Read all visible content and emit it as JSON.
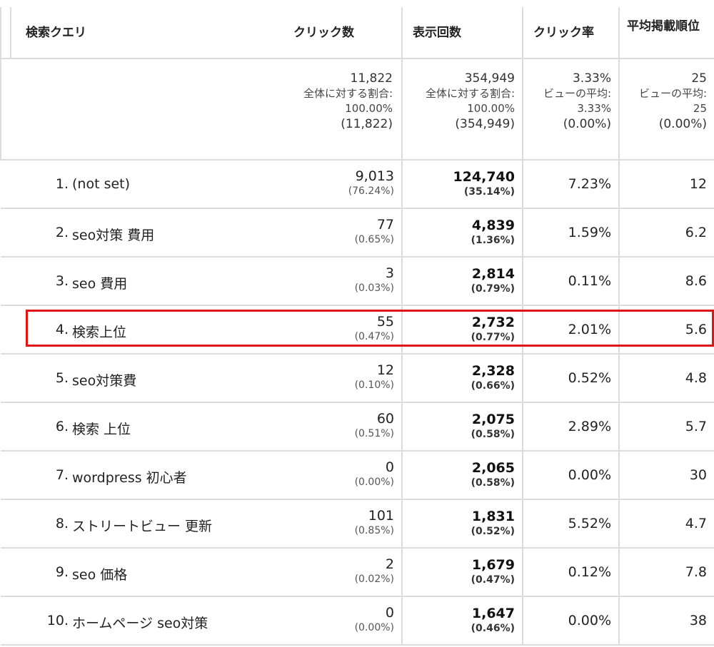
{
  "header": {
    "query": "検索クエリ",
    "clicks": "クリック数",
    "impressions": "表示回数",
    "ctr": "クリック率",
    "position": "平均掲載順位"
  },
  "summary": {
    "clicks": {
      "value": "11,822",
      "label": "全体に対する割合:",
      "pct": "100.00%",
      "total": "(11,822)"
    },
    "impressions": {
      "value": "354,949",
      "label": "全体に対する割合:",
      "pct": "100.00%",
      "total": "(354,949)"
    },
    "ctr": {
      "value": "3.33%",
      "label": "ビューの平均:",
      "avg": "3.33%",
      "diff": "(0.00%)"
    },
    "position": {
      "value": "25",
      "label": "ビューの平均:",
      "avg": "25",
      "diff": "(0.00%)"
    }
  },
  "rows": [
    {
      "rank": "1.",
      "query": "(not set)",
      "clicks": "9,013",
      "clicks_pct": "(76.24%)",
      "impressions": "124,740",
      "impressions_pct": "(35.14%)",
      "ctr": "7.23%",
      "position": "12"
    },
    {
      "rank": "2.",
      "query": "seo対策 費用",
      "clicks": "77",
      "clicks_pct": "(0.65%)",
      "impressions": "4,839",
      "impressions_pct": "(1.36%)",
      "ctr": "1.59%",
      "position": "6.2"
    },
    {
      "rank": "3.",
      "query": "seo 費用",
      "clicks": "3",
      "clicks_pct": "(0.03%)",
      "impressions": "2,814",
      "impressions_pct": "(0.79%)",
      "ctr": "0.11%",
      "position": "8.6"
    },
    {
      "rank": "4.",
      "query": "検索上位",
      "clicks": "55",
      "clicks_pct": "(0.47%)",
      "impressions": "2,732",
      "impressions_pct": "(0.77%)",
      "ctr": "2.01%",
      "position": "5.6"
    },
    {
      "rank": "5.",
      "query": "seo対策費",
      "clicks": "12",
      "clicks_pct": "(0.10%)",
      "impressions": "2,328",
      "impressions_pct": "(0.66%)",
      "ctr": "0.52%",
      "position": "4.8"
    },
    {
      "rank": "6.",
      "query": "検索 上位",
      "clicks": "60",
      "clicks_pct": "(0.51%)",
      "impressions": "2,075",
      "impressions_pct": "(0.58%)",
      "ctr": "2.89%",
      "position": "5.7"
    },
    {
      "rank": "7.",
      "query": "wordpress 初心者",
      "clicks": "0",
      "clicks_pct": "(0.00%)",
      "impressions": "2,065",
      "impressions_pct": "(0.58%)",
      "ctr": "0.00%",
      "position": "30"
    },
    {
      "rank": "8.",
      "query": "ストリートビュー 更新",
      "clicks": "101",
      "clicks_pct": "(0.85%)",
      "impressions": "1,831",
      "impressions_pct": "(0.52%)",
      "ctr": "5.52%",
      "position": "4.7"
    },
    {
      "rank": "9.",
      "query": "seo 価格",
      "clicks": "2",
      "clicks_pct": "(0.02%)",
      "impressions": "1,679",
      "impressions_pct": "(0.47%)",
      "ctr": "0.12%",
      "position": "7.8"
    },
    {
      "rank": "10.",
      "query": "ホームページ seo対策",
      "clicks": "0",
      "clicks_pct": "(0.00%)",
      "impressions": "1,647",
      "impressions_pct": "(0.46%)",
      "ctr": "0.00%",
      "position": "38"
    }
  ],
  "highlight_color": "#e01414"
}
